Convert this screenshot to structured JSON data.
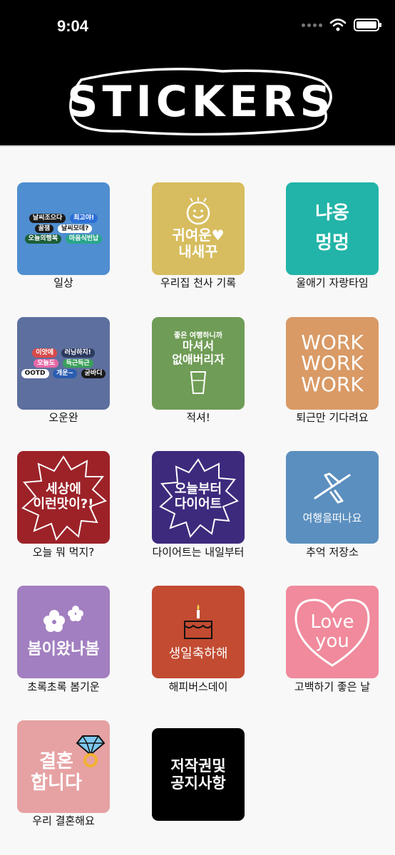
{
  "status": {
    "time": "9:04"
  },
  "header": {
    "logo_text": "STICKERS"
  },
  "stickers": [
    {
      "label": "일상",
      "art": [
        "날씨조으다",
        "최고야!",
        "꿀잼",
        "날씨모데?",
        "오늘의행복",
        "마음식빈납"
      ],
      "bg": "#4f8ed0"
    },
    {
      "label": "우리집 천사 기록",
      "art": [
        "귀여운♥",
        "내새꾸"
      ],
      "bg": "#d7bd5f"
    },
    {
      "label": "울애기 자랑타임",
      "art": [
        "냐옹",
        "멍멍"
      ],
      "bg": "#22b4a8"
    },
    {
      "label": "오운완",
      "art": [
        "이앗에",
        "러닝하지!",
        "오늘도",
        "득근득근",
        "OOTD",
        "개운~",
        "굳바디"
      ],
      "bg": "#5d6f9e"
    },
    {
      "label": "적셔!",
      "art": [
        "좋은 여행하니까",
        "마셔서",
        "없애버리자"
      ],
      "bg": "#6f9c56"
    },
    {
      "label": "퇴근만 기다려요",
      "art": [
        "WORK",
        "WORK",
        "WORK"
      ],
      "bg": "#d99a66"
    },
    {
      "label": "오늘 뭐 먹지?",
      "art": [
        "세상에",
        "이런맛이?!"
      ],
      "bg": "#9c2228"
    },
    {
      "label": "다이어트는 내일부터",
      "art": [
        "오늘부터",
        "다이어트"
      ],
      "bg": "#3e2a7d"
    },
    {
      "label": "추억 저장소",
      "art": [
        "여행을떠나요"
      ],
      "bg": "#5b8fbf"
    },
    {
      "label": "초록초록 봄기운",
      "art": [
        "봄이왔나봄"
      ],
      "bg": "#a27fc0"
    },
    {
      "label": "해피버스데이",
      "art": [
        "생일축하해"
      ],
      "bg": "#c24b32"
    },
    {
      "label": "고백하기 좋은 날",
      "art": [
        "Love",
        "you"
      ],
      "bg": "#f08a9c"
    },
    {
      "label": "우리 결혼해요",
      "art": [
        "결혼",
        "합니다"
      ],
      "bg": "#e6a2a3"
    },
    {
      "label": "",
      "art": [
        "저작권및",
        "공지사항"
      ],
      "bg": "#000000"
    }
  ]
}
